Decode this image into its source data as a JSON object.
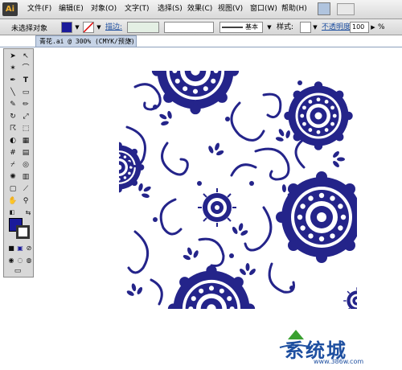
{
  "app": {
    "logo": "Ai"
  },
  "menu": [
    "文件(F)",
    "编辑(E)",
    "对象(O)",
    "文字(T)",
    "选择(S)",
    "效果(C)",
    "视图(V)",
    "窗口(W)",
    "帮助(H)"
  ],
  "control_bar": {
    "selection_label": "未选择对象",
    "stroke_label": "描边:",
    "brush_label": "基本",
    "style_label": "样式:",
    "opacity_label": "不透明度:",
    "opacity_value": "100",
    "opacity_unit": "%"
  },
  "document_tab": {
    "title": "青花.ai @ 300% (CMYK/预览)",
    "close": "×"
  },
  "colors": {
    "fill": "#1a1a9a",
    "pattern": "#24248a",
    "watermark": "#1e4fa0"
  },
  "watermark": {
    "text": "系统城",
    "url": "www.386w.com"
  }
}
